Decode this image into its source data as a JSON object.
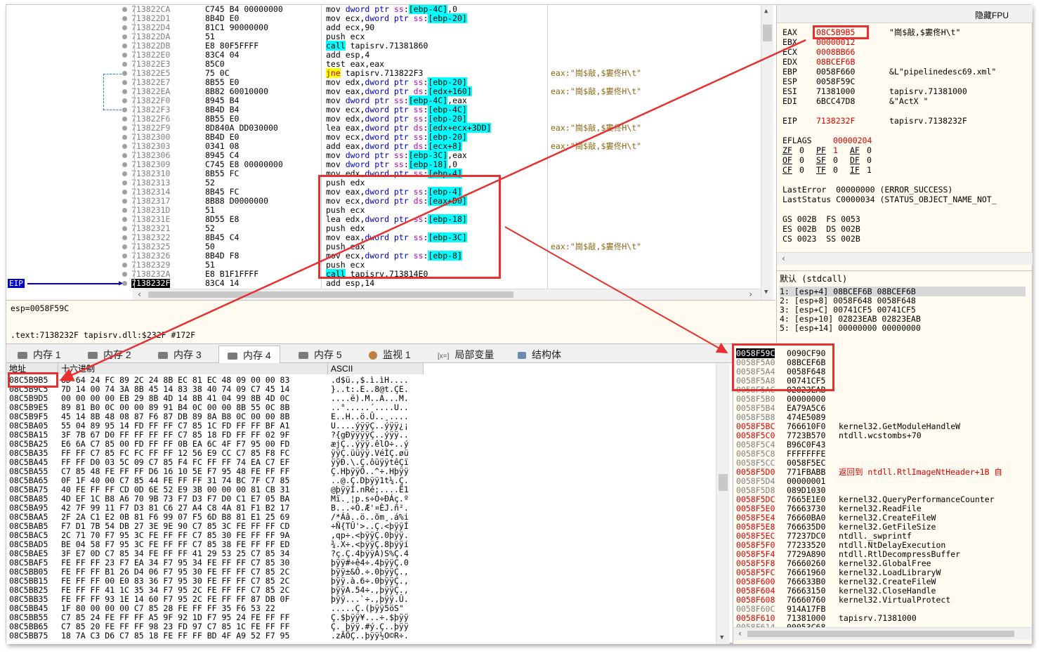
{
  "disasm": [
    {
      "addr": "713822CA",
      "bytes": "C745 B4 00000000",
      "instr": "mov dword ptr ss:[ebp-4C],0",
      "comment": ""
    },
    {
      "addr": "713822D1",
      "bytes": "8B4D E0",
      "instr": "mov ecx,dword ptr ss:[ebp-20]",
      "comment": ""
    },
    {
      "addr": "713822D4",
      "bytes": "81C1 90000000",
      "instr": "add ecx,90",
      "comment": ""
    },
    {
      "addr": "713822DA",
      "bytes": "51",
      "instr": "push ecx",
      "comment": ""
    },
    {
      "addr": "713822DB",
      "bytes": "E8 80F5FFFF",
      "instr": "call tapisrv.71381860",
      "comment": ""
    },
    {
      "addr": "713822E0",
      "bytes": "83C4 04",
      "instr": "add esp,4",
      "comment": ""
    },
    {
      "addr": "713822E3",
      "bytes": "85C0",
      "instr": "test eax,eax",
      "comment": ""
    },
    {
      "addr": "713822E5",
      "bytes": "75 0C",
      "instr": "jne tapisrv.713822F3",
      "comment": "eax:\"崗$敲,$婁佟H\\t\""
    },
    {
      "addr": "713822E7",
      "bytes": "8B55 E0",
      "instr": "mov edx,dword ptr ss:[ebp-20]",
      "comment": ""
    },
    {
      "addr": "713822EA",
      "bytes": "8B82 60010000",
      "instr": "mov eax,dword ptr ds:[edx+160]",
      "comment": "eax:\"崗$敲,$婁佟H\\t\""
    },
    {
      "addr": "713822F0",
      "bytes": "8945 B4",
      "instr": "mov dword ptr ss:[ebp-4C],eax",
      "comment": ""
    },
    {
      "addr": "713822F3",
      "bytes": "8B4D B4",
      "instr": "mov ecx,dword ptr ss:[ebp-4C]",
      "comment": ""
    },
    {
      "addr": "713822F6",
      "bytes": "8B55 E0",
      "instr": "mov edx,dword ptr ss:[ebp-20]",
      "comment": ""
    },
    {
      "addr": "713822F9",
      "bytes": "8D840A DD030000",
      "instr": "lea eax,dword ptr ds:[edx+ecx+3DD]",
      "comment": "eax:\"崗$敲,$婁佟H\\t\""
    },
    {
      "addr": "71382300",
      "bytes": "8B4D E0",
      "instr": "mov ecx,dword ptr ss:[ebp-20]",
      "comment": ""
    },
    {
      "addr": "71382303",
      "bytes": "0341 08",
      "instr": "add eax,dword ptr ds:[ecx+8]",
      "comment": "eax:\"崗$敲,$婁佟H\\t\""
    },
    {
      "addr": "71382306",
      "bytes": "8945 C4",
      "instr": "mov dword ptr ss:[ebp-3C],eax",
      "comment": ""
    },
    {
      "addr": "71382309",
      "bytes": "C745 E8 00000000",
      "instr": "mov dword ptr ss:[ebp-18],0",
      "comment": ""
    },
    {
      "addr": "71382310",
      "bytes": "8B55 FC",
      "instr": "mov edx,dword ptr ss:[ebp-4]",
      "comment": ""
    },
    {
      "addr": "71382313",
      "bytes": "52",
      "instr": "push edx",
      "comment": ""
    },
    {
      "addr": "71382314",
      "bytes": "8B45 FC",
      "instr": "mov eax,dword ptr ss:[ebp-4]",
      "comment": ""
    },
    {
      "addr": "71382317",
      "bytes": "8B88 D0000000",
      "instr": "mov ecx,dword ptr ds:[eax+D0]",
      "comment": ""
    },
    {
      "addr": "7138231D",
      "bytes": "51",
      "instr": "push ecx",
      "comment": ""
    },
    {
      "addr": "7138231E",
      "bytes": "8D55 E8",
      "instr": "lea edx,dword ptr ss:[ebp-18]",
      "comment": ""
    },
    {
      "addr": "71382321",
      "bytes": "52",
      "instr": "push edx",
      "comment": ""
    },
    {
      "addr": "71382322",
      "bytes": "8B45 C4",
      "instr": "mov eax,dword ptr ss:[ebp-3C]",
      "comment": ""
    },
    {
      "addr": "71382325",
      "bytes": "50",
      "instr": "push eax",
      "comment": "eax:\"崗$敲,$婁佟H\\t\""
    },
    {
      "addr": "71382326",
      "bytes": "8B4D F8",
      "instr": "mov ecx,dword ptr ss:[ebp-8]",
      "comment": ""
    },
    {
      "addr": "71382329",
      "bytes": "51",
      "instr": "push ecx",
      "comment": ""
    },
    {
      "addr": "7138232A",
      "bytes": "E8 B1F1FFFF",
      "instr": "call tapisrv.713814E0",
      "comment": ""
    },
    {
      "addr": "7138232F",
      "bytes": "83C4 14",
      "instr": "add esp,14",
      "comment": ""
    }
  ],
  "eip_label": "EIP",
  "info_line1": "esp=0058F59C",
  "info_line2": ".text:7138232F tapisrv.dll:$232F #172F",
  "tabs": [
    "内存 1",
    "内存 2",
    "内存 3",
    "内存 4",
    "内存 5",
    "监视 1",
    "局部变量",
    "结构体"
  ],
  "dump_headers": {
    "addr": "地址",
    "hex": "十六进制",
    "ascii": "ASCII"
  },
  "dump": [
    [
      "08C5B9B5",
      "8D 64 24 FC 89 2C 24 8B EC 81 EC 48 09 00 00 83",
      ".d$ü.,$.ì.ìH...."
    ],
    [
      "08C5B9C5",
      "7D 14 00 74 3A 8B 45 14 83 38 40 74 09 C7 45 14",
      "}..t:.E..8@t.ÇE."
    ],
    [
      "08C5B9D5",
      "00 00 00 00 EB 29 8B 4D 14 8B 41 04 99 8B 4D 0C",
      "....ë).M..A...M."
    ],
    [
      "08C5B9E5",
      "89 81 B0 0C 00 00 89 91 B4 0C 00 00 8B 55 0C 8B",
      "..°.....´....U.."
    ],
    [
      "08C5B9F5",
      "45 14 8B 48 08 87 F6 87 DB 89 8A B8 0C 00 00 8B",
      "E..H..ö.Û..¸...."
    ],
    [
      "08C5BA05",
      "55 04 89 95 14 FD FF FF C7 85 1C FD FF FF BF A1",
      "U....ýÿÿÇ..ýÿÿ¿¡"
    ],
    [
      "08C5BA15",
      "3F 7B 67 D0 FF FF FF FF C7 85 18 FD FF FF 02 9F",
      "?{gÐÿÿÿÿÇ..ýÿÿ.."
    ],
    [
      "08C5BA25",
      "E6 6A C7 85 00 FD FF FF 0B EA 6C 4F F7 95 00 FD",
      "æjÇ..ýÿÿ.êlO÷..ý"
    ],
    [
      "08C5BA35",
      "FF FF C7 85 FC FC FF FF 12 56 E9 CC C7 85 F8 FC",
      "ÿÿÇ.üüÿÿ.VéÌÇ.øü"
    ],
    [
      "08C5BA45",
      "FF FF D0 03 5C 09 C7 85 F4 FC FF FF 74 EA C7 EF",
      "ÿÿÐ.\\.Ç.ôüÿÿtêÇï"
    ],
    [
      "08C5BA55",
      "C7 85 48 FE FF FF D6 16 10 5E F7 95 48 FE FF FF",
      "Ç.HþÿÿÖ..^÷.Hþÿÿ"
    ],
    [
      "08C5BA65",
      "0F 1F 40 00 C7 85 44 FE FF FF 31 74 BC 7F C7 85",
      "..@.Ç.Dþÿÿ1t¼.Ç."
    ],
    [
      "08C5BA75",
      "40 FE FF FF CD 0D 6E 52 E9 3B 00 00 00 81 CB 31",
      "@þÿÿÍ.nRé;....Ë1"
    ],
    [
      "08C5BA85",
      "4D EF 1C B8 A6 70 9B 73 F7 D3 F7 D0 C1 E7 05 BA",
      "Mï.¸¦p.s÷Ó÷ÐÁç.º"
    ],
    [
      "08C5BA95",
      "42 7F 99 11 F7 D3 81 C6 27 A4 C8 4A 81 F1 B2 17",
      "B...÷Ó.Æ'¤ÈJ.ñ²."
    ],
    [
      "08C5BAA5",
      "2F 2A C1 E2 0B 81 F6 99 07 F5 6D B8 81 E1 25 69",
      "/*Áâ..ö..õm¸.á%i"
    ],
    [
      "08C5BAB5",
      "F7 D1 7B 54 DB 27 3E 9E 90 C7 85 3C FE FF FF CD",
      "÷Ñ{TÛ'>..Ç.<þÿÿÍ"
    ],
    [
      "08C5BAC5",
      "2C 71 70 F7 95 3C FE FF FF C7 85 30 FE FF FF 9A",
      ",qp÷.<þÿÿÇ.0þÿÿ."
    ],
    [
      "08C5BAD5",
      "BE 04 58 F7 95 3C FE FF FF C7 85 38 FE FF FF ED",
      "¾.X÷.<þÿÿÇ.8þÿÿí"
    ],
    [
      "08C5BAE5",
      "3F E7 0D C7 85 34 FE FF FF 41 29 53 25 C7 85 34",
      "?ç.Ç.4þÿÿA)S%Ç.4"
    ],
    [
      "08C5BAF5",
      "FE FF FF 23 F7 EA 34 F7 95 34 FE FF FF C7 85 30",
      "þÿÿ#÷ê4÷.4þÿÿÇ.0"
    ],
    [
      "08C5BB05",
      "FE FF FF B1 26 D4 06 F7 95 30 FE FF FF C7 85 2C",
      "þÿÿ±&Ô.÷.0þÿÿÇ.,"
    ],
    [
      "08C5BB15",
      "FE FF FF 00 E0 83 36 F7 95 30 FE FF FF C7 85 2C",
      "þÿÿ.à.6÷.0þÿÿÇ.,"
    ],
    [
      "08C5BB25",
      "FE FF FF 41 1C 35 34 F7 95 2C FE FF FF C7 85 2C",
      "þÿÿA.54÷.,þÿÿÇ.,"
    ],
    [
      "08C5BB35",
      "FE FF FF 93 1E 14 60 F7 95 2C FE FF FF 87 DB 0F",
      "þÿÿ...`÷.,þÿÿ.Û."
    ],
    [
      "08C5BB45",
      "1F 80 00 00 00 C7 85 28 FE FF FF 35 F6 53 22",
      ".....Ç.(þÿÿ5öS\""
    ],
    [
      "08C5BB55",
      "C7 85 24 FE FF FF A5 9F 92 1D F7 95 24 FE FF FF",
      "Ç.$þÿÿ¥...÷.$þÿÿ"
    ],
    [
      "08C5BB65",
      "C7 85 20 FE FF FF 98 23 FD 97 C7 85 1C FE FF FF",
      "Ç. þÿÿ.#ý.Ç..þÿÿ"
    ],
    [
      "08C5BB75",
      "18 7A C3 D6 C7 85 18 FE FF FF BD 4F A9 52 F7 95",
      ".zÃÖÇ..þÿÿ½O©R÷."
    ]
  ],
  "regs_header": "隐藏FPU",
  "regs": [
    {
      "name": "EAX",
      "value": "08C5B9B5",
      "comment": "\"崗$敲,$婁佟H\\t\"",
      "changed": true
    },
    {
      "name": "EBX",
      "value": "00000012",
      "comment": "",
      "changed": true
    },
    {
      "name": "ECX",
      "value": "0008BB66",
      "comment": "",
      "changed": true
    },
    {
      "name": "EDX",
      "value": "08BCEF6B",
      "comment": "",
      "changed": true
    },
    {
      "name": "EBP",
      "value": "0058F660",
      "comment": "&L\"pipelinedesc69.xml\"",
      "changed": false
    },
    {
      "name": "ESP",
      "value": "0058F59C",
      "comment": "",
      "changed": false
    },
    {
      "name": "ESI",
      "value": "71381000",
      "comment": "tapisrv.71381000",
      "changed": false
    },
    {
      "name": "EDI",
      "value": "6BCC47D8",
      "comment": "&\"ActX \"",
      "changed": false
    }
  ],
  "eip_reg": {
    "name": "EIP",
    "value": "7138232F",
    "comment": "tapisrv.7138232F"
  },
  "eflags": {
    "name": "EFLAGS",
    "value": "00000204"
  },
  "flags": [
    [
      "ZF",
      "0",
      "PF",
      "1",
      "AF",
      "0"
    ],
    [
      "OF",
      "0",
      "SF",
      "0",
      "DF",
      "0"
    ],
    [
      "CF",
      "0",
      "TF",
      "0",
      "IF",
      "1"
    ]
  ],
  "last_error": "LastError  00000000 (ERROR_SUCCESS)",
  "last_status": "LastStatus C0000034 (STATUS_OBJECT_NAME_NOT_",
  "segs": [
    "GS 002B  FS 0053",
    "ES 002B  DS 002B",
    "CS 0023  SS 002B"
  ],
  "callconv": "默认 (stdcall)",
  "args": [
    "1: [esp+4] 08BCEF6B 08BCEF6B",
    "2: [esp+8] 0058F648 0058F648",
    "3: [esp+C] 00741CF5 00741CF5",
    "4: [esp+10] 02823EAB 02823EAB",
    "5: [esp+14] 00000000 00000000"
  ],
  "stack": [
    [
      "0058F59C",
      "0090CF90",
      ""
    ],
    [
      "0058F5A0",
      "08BCEF6B",
      ""
    ],
    [
      "0058F5A4",
      "0058F648",
      ""
    ],
    [
      "0058F5A8",
      "00741CF5",
      ""
    ],
    [
      "0058F5AC",
      "02823EAB",
      ""
    ],
    [
      "0058F5B0",
      "00000000",
      ""
    ],
    [
      "0058F5B4",
      "EA79A5C6",
      ""
    ],
    [
      "0058F5B8",
      "474E5089",
      ""
    ],
    [
      "0058F5BC",
      "766610F0",
      "kernel32.GetModuleHandleW"
    ],
    [
      "0058F5C0",
      "7723B570",
      "ntdll.wcstombs+70"
    ],
    [
      "0058F5C4",
      "B96C0F43",
      ""
    ],
    [
      "0058F5C8",
      "FFFFFFFE",
      ""
    ],
    [
      "0058F5CC",
      "0058F5EC",
      ""
    ],
    [
      "0058F5D0",
      "771FBABB",
      "返回到 ntdll.RtlImageNtHeader+1B 自"
    ],
    [
      "0058F5D4",
      "00000001",
      ""
    ],
    [
      "0058F5D8",
      "089D1030",
      ""
    ],
    [
      "0058F5DC",
      "7665E1E0",
      "kernel32.QueryPerformanceCounter"
    ],
    [
      "0058F5E0",
      "76663730",
      "kernel32.ReadFile"
    ],
    [
      "0058F5E4",
      "76660BA0",
      "kernel32.CreateFileW"
    ],
    [
      "0058F5E8",
      "766635D0",
      "kernel32.GetFileSize"
    ],
    [
      "0058F5EC",
      "77237DC0",
      "ntdll._swprintf"
    ],
    [
      "0058F5F0",
      "77233520",
      "ntdll.NtDelayExecution"
    ],
    [
      "0058F5F4",
      "7729A890",
      "ntdll.RtlDecompressBuffer"
    ],
    [
      "0058F5F8",
      "76660260",
      "kernel32.GlobalFree"
    ],
    [
      "0058F5FC",
      "76661960",
      "kernel32.LoadLibraryW"
    ],
    [
      "0058F600",
      "766633B0",
      "kernel32.CreateFileW"
    ],
    [
      "0058F604",
      "76663150",
      "kernel32.CloseHandle"
    ],
    [
      "0058F608",
      "76660760",
      "kernel32.VirtualProtect"
    ],
    [
      "0058F60C",
      "914A17FB",
      ""
    ],
    [
      "0058F610",
      "71381000",
      "tapisrv.71381000"
    ],
    [
      "0058F614",
      "00053C68",
      ""
    ]
  ]
}
